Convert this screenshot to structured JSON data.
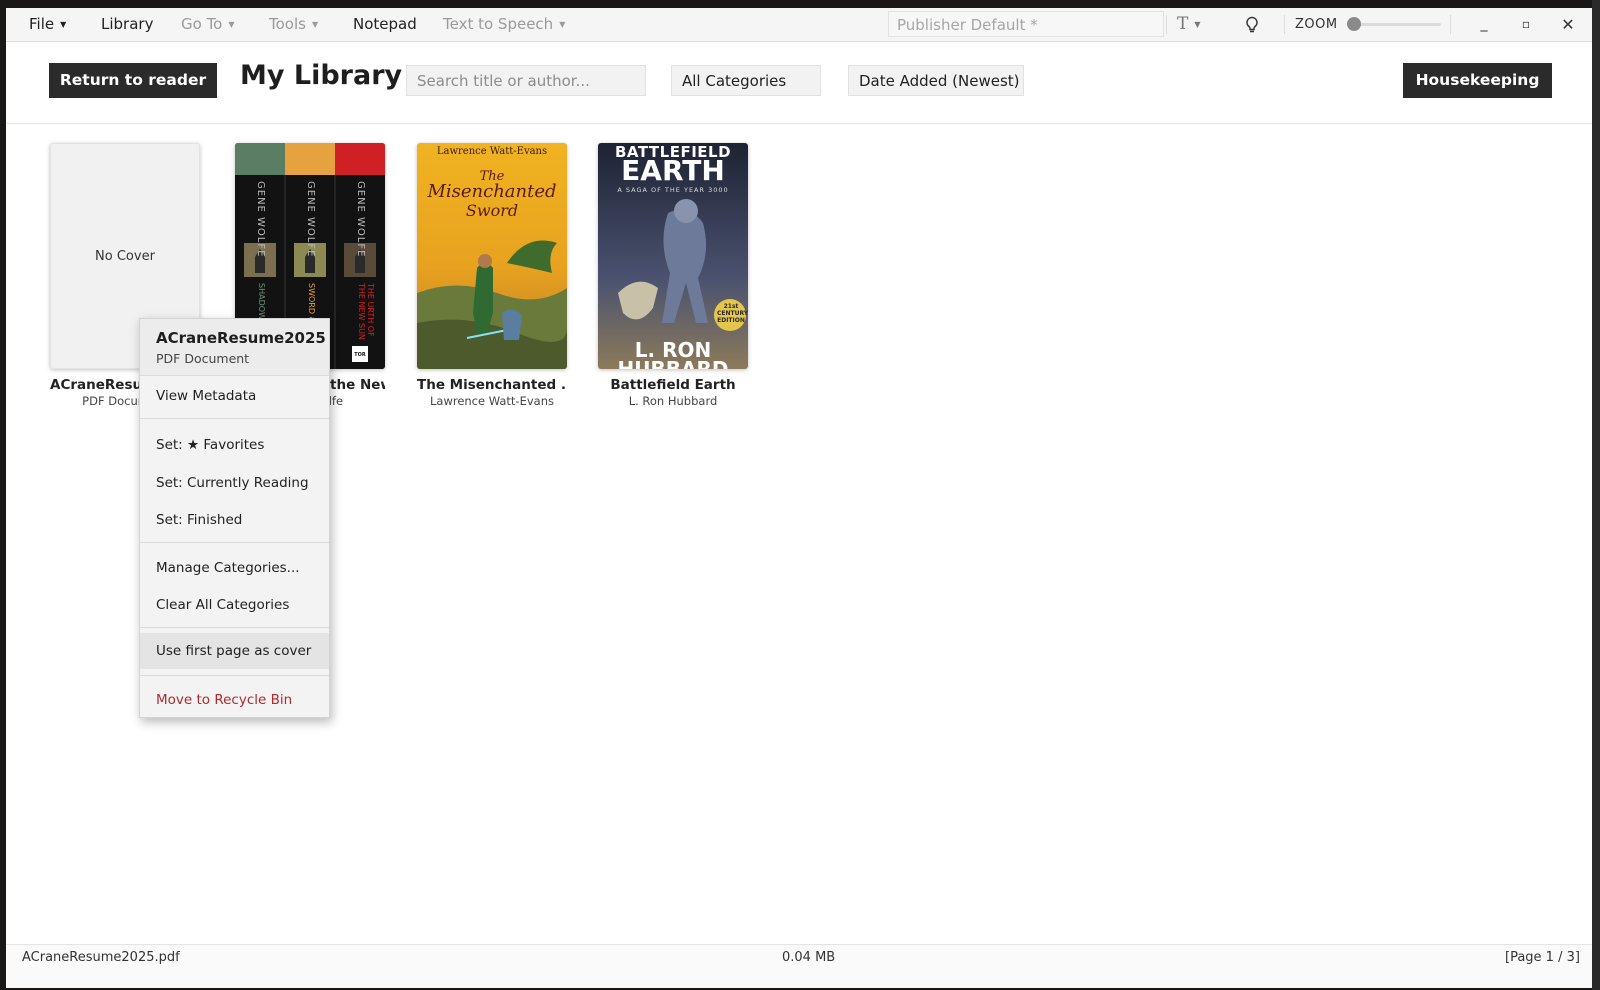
{
  "menubar": {
    "file": "File",
    "library": "Library",
    "goto": "Go To",
    "tools": "Tools",
    "notepad": "Notepad",
    "tts": "Text to Speech",
    "preset": "Publisher Default *",
    "font_button": "T",
    "zoom_label": "ZOOM",
    "zoom_level": 0,
    "minimize": "_",
    "maximize": "▫",
    "close": "✕"
  },
  "toolbar": {
    "return_label": "Return to reader",
    "title": "My Library",
    "search_placeholder": "Search title or author...",
    "category": "All Categories",
    "sort": "Date Added (Newest)",
    "housekeeping": "Housekeeping"
  },
  "books": [
    {
      "title": "ACraneResume2025",
      "author": "PDF Document",
      "cover_text": "No Cover"
    },
    {
      "title": "The Book of the New Sun Boo...",
      "author": "Gene Wolfe"
    },
    {
      "title": "The Misenchanted ...",
      "author": "Lawrence Watt-Evans",
      "cover_author": "Lawrence Watt-Evans",
      "cover_title_1": "The",
      "cover_title_2": "Misenchanted",
      "cover_title_3": "Sword"
    },
    {
      "title": "Battlefield Earth",
      "author": "L. Ron Hubbard",
      "cover_top": "BATTLEFIELD",
      "cover_mid": "EARTH",
      "cover_sub": "A SAGA OF THE YEAR 3000",
      "cover_author": "L. RON",
      "cover_author2": "HUBBARD",
      "badge_1": "21st",
      "badge_2": "CENTURY",
      "badge_3": "EDITION"
    }
  ],
  "boxset": {
    "spine_author": "GENE WOLFE",
    "spine_1": "SHADOW & CLAW",
    "spine_2": "SWORD & CITADEL",
    "spine_3": "THE URTH OF THE NEW SUN",
    "publisher": "TOR",
    "colors": [
      "#5a7d63",
      "#e5a23f",
      "#cf2026"
    ]
  },
  "context_menu": {
    "title": "ACraneResume2025",
    "subtitle": "PDF Document",
    "view_metadata": "View Metadata",
    "set_favorites": "Set: ★ Favorites",
    "set_reading": "Set: Currently Reading",
    "set_finished": "Set: Finished",
    "manage_categories": "Manage Categories...",
    "clear_categories": "Clear All Categories",
    "use_first_page": "Use first page as cover",
    "recycle": "Move to Recycle Bin"
  },
  "statusbar": {
    "file": "ACraneResume2025.pdf",
    "size": "0.04 MB",
    "page": "[Page 1 / 3]"
  }
}
